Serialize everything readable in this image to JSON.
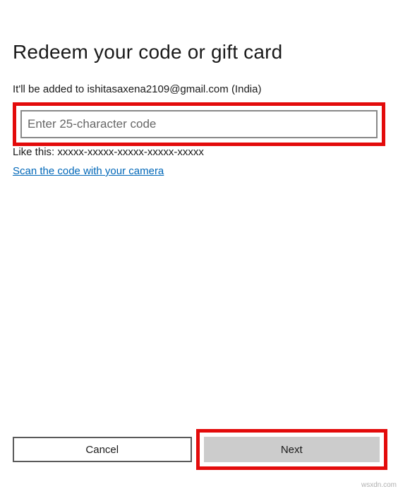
{
  "page": {
    "title": "Redeem your code or gift card",
    "subtitle": "It'll be added to ishitasaxena2109@gmail.com (India)",
    "input_placeholder": "Enter 25-character code",
    "hint": "Like this: xxxxx-xxxxx-xxxxx-xxxxx-xxxxx",
    "scan_link": "Scan the code with your camera"
  },
  "buttons": {
    "cancel": "Cancel",
    "next": "Next"
  },
  "watermark": "wsxdn.com"
}
